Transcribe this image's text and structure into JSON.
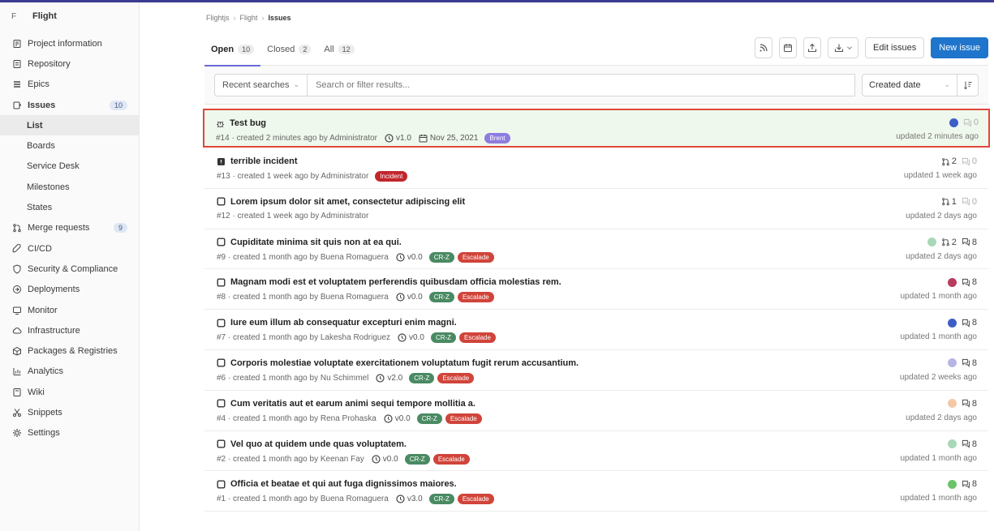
{
  "project": {
    "avatar_letter": "F",
    "name": "Flight"
  },
  "sidebar": {
    "items": [
      {
        "label": "Project information",
        "icon": "info-icon"
      },
      {
        "label": "Repository",
        "icon": "book-icon"
      },
      {
        "label": "Epics",
        "icon": "epic-icon"
      },
      {
        "label": "Issues",
        "icon": "issues-icon",
        "badge": "10"
      },
      {
        "label": "List",
        "sub": true
      },
      {
        "label": "Boards",
        "sub": true
      },
      {
        "label": "Service Desk",
        "sub": true
      },
      {
        "label": "Milestones",
        "sub": true
      },
      {
        "label": "States",
        "sub": true
      },
      {
        "label": "Merge requests",
        "icon": "merge-request-icon",
        "badge": "9"
      },
      {
        "label": "CI/CD",
        "icon": "rocket-icon"
      },
      {
        "label": "Security & Compliance",
        "icon": "shield-icon"
      },
      {
        "label": "Deployments",
        "icon": "deployments-icon"
      },
      {
        "label": "Monitor",
        "icon": "monitor-icon"
      },
      {
        "label": "Infrastructure",
        "icon": "cloud-icon"
      },
      {
        "label": "Packages & Registries",
        "icon": "package-icon"
      },
      {
        "label": "Analytics",
        "icon": "analytics-icon"
      },
      {
        "label": "Wiki",
        "icon": "wiki-icon"
      },
      {
        "label": "Snippets",
        "icon": "scissors-icon"
      },
      {
        "label": "Settings",
        "icon": "gear-icon"
      }
    ]
  },
  "breadcrumb": {
    "group": "Flightjs",
    "project": "Flight",
    "current": "Issues"
  },
  "tabs": [
    {
      "label": "Open",
      "count": "10"
    },
    {
      "label": "Closed",
      "count": "2"
    },
    {
      "label": "All",
      "count": "12"
    }
  ],
  "toolbar": {
    "edit_label": "Edit issues",
    "new_label": "New issue"
  },
  "filter": {
    "recent_label": "Recent searches",
    "search_placeholder": "Search or filter results...",
    "sort_label": "Created date"
  },
  "colors": {
    "primary": "#1f75cb",
    "cr_z": "#4a8a63",
    "escalade": "#d0443a",
    "incident": "#c1262c",
    "brent": "#8d7ce0",
    "highlight_border": "#e0473b"
  },
  "issues": [
    {
      "title": "Test bug",
      "type_icon": "bug-icon",
      "meta": "#14 · created 2 minutes ago by Administrator",
      "milestone": "v1.0",
      "due": "Nov 25, 2021",
      "labels": [
        {
          "text": "Brent",
          "color": "#8d7ce0"
        }
      ],
      "mrs": "",
      "comments": "0",
      "assignee_color": "#3d5ec9",
      "updated": "updated 2 minutes ago"
    },
    {
      "title": "terrible incident",
      "type_icon": "incident-icon",
      "meta": "#13 · created 1 week ago by Administrator",
      "milestone": "",
      "due": "",
      "labels": [
        {
          "text": "Incident",
          "color": "#c1262c"
        }
      ],
      "mrs": "2",
      "comments": "0",
      "assignee_color": "",
      "updated": "updated 1 week ago"
    },
    {
      "title": "Lorem ipsum dolor sit amet, consectetur adipiscing elit",
      "type_icon": "issue-icon",
      "meta": "#12 · created 1 week ago by Administrator",
      "milestone": "",
      "due": "",
      "labels": [],
      "mrs": "1",
      "comments": "0",
      "assignee_color": "",
      "updated": "updated 2 days ago"
    },
    {
      "title": "Cupiditate minima sit quis non at ea qui.",
      "type_icon": "issue-icon",
      "meta": "#9 · created 1 month ago by Buena Romaguera",
      "milestone": "v0.0",
      "due": "",
      "labels": [
        {
          "text": "CR-Z",
          "color": "#4a8a63"
        },
        {
          "text": "Escalade",
          "color": "#d0443a"
        }
      ],
      "mrs": "2",
      "comments": "8",
      "assignee_color": "#a8d8b8",
      "updated": "updated 2 days ago"
    },
    {
      "title": "Magnam modi est et voluptatem perferendis quibusdam officia molestias rem.",
      "type_icon": "issue-icon",
      "meta": "#8 · created 1 month ago by Buena Romaguera",
      "milestone": "v0.0",
      "due": "",
      "labels": [
        {
          "text": "CR-Z",
          "color": "#4a8a63"
        },
        {
          "text": "Escalade",
          "color": "#d0443a"
        }
      ],
      "mrs": "",
      "comments": "8",
      "assignee_color": "#b83c5c",
      "updated": "updated 1 month ago"
    },
    {
      "title": "Iure eum illum ab consequatur excepturi enim magni.",
      "type_icon": "issue-icon",
      "meta": "#7 · created 1 month ago by Lakesha Rodriguez",
      "milestone": "v0.0",
      "due": "",
      "labels": [
        {
          "text": "CR-Z",
          "color": "#4a8a63"
        },
        {
          "text": "Escalade",
          "color": "#d0443a"
        }
      ],
      "mrs": "",
      "comments": "8",
      "assignee_color": "#3d5ec9",
      "updated": "updated 1 month ago"
    },
    {
      "title": "Corporis molestiae voluptate exercitationem voluptatum fugit rerum accusantium.",
      "type_icon": "issue-icon",
      "meta": "#6 · created 1 month ago by Nu Schimmel",
      "milestone": "v2.0",
      "due": "",
      "labels": [
        {
          "text": "CR-Z",
          "color": "#4a8a63"
        },
        {
          "text": "Escalade",
          "color": "#d0443a"
        }
      ],
      "mrs": "",
      "comments": "8",
      "assignee_color": "#b9b4e6",
      "updated": "updated 2 weeks ago"
    },
    {
      "title": "Cum veritatis aut et earum animi sequi tempore mollitia a.",
      "type_icon": "issue-icon",
      "meta": "#4 · created 1 month ago by Rena Prohaska",
      "milestone": "v0.0",
      "due": "",
      "labels": [
        {
          "text": "CR-Z",
          "color": "#4a8a63"
        },
        {
          "text": "Escalade",
          "color": "#d0443a"
        }
      ],
      "mrs": "",
      "comments": "8",
      "assignee_color": "#f2c9a8",
      "updated": "updated 2 days ago"
    },
    {
      "title": "Vel quo at quidem unde quas voluptatem.",
      "type_icon": "issue-icon",
      "meta": "#2 · created 1 month ago by Keenan Fay",
      "milestone": "v0.0",
      "due": "",
      "labels": [
        {
          "text": "CR-Z",
          "color": "#4a8a63"
        },
        {
          "text": "Escalade",
          "color": "#d0443a"
        }
      ],
      "mrs": "",
      "comments": "8",
      "assignee_color": "#a8d8b8",
      "updated": "updated 1 month ago"
    },
    {
      "title": "Officia et beatae et qui aut fuga dignissimos maiores.",
      "type_icon": "issue-icon",
      "meta": "#1 · created 1 month ago by Buena Romaguera",
      "milestone": "v3.0",
      "due": "",
      "labels": [
        {
          "text": "CR-Z",
          "color": "#4a8a63"
        },
        {
          "text": "Escalade",
          "color": "#d0443a"
        }
      ],
      "mrs": "",
      "comments": "8",
      "assignee_color": "#6cc46a",
      "updated": "updated 1 month ago"
    }
  ]
}
